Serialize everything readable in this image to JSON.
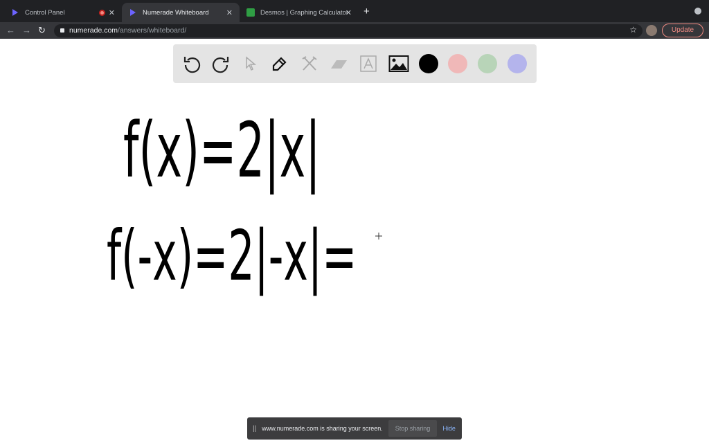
{
  "tabs": [
    {
      "label": "Control Panel",
      "recording": true
    },
    {
      "label": "Numerade Whiteboard",
      "active": true
    },
    {
      "label": "Desmos | Graphing Calculator"
    }
  ],
  "address": {
    "domain": "numerade.com",
    "path": "/answers/whiteboard/"
  },
  "update_label": "Update",
  "whiteboard_tools": [
    "undo",
    "redo",
    "select",
    "pen",
    "tools",
    "eraser",
    "text",
    "image"
  ],
  "colors": {
    "black": "#000000",
    "red": "#f0b8b8",
    "green": "#b8d4b8",
    "blue": "#b4b4ec"
  },
  "handwriting": [
    "f(x)=2|x|",
    "f(-x)=2|-x|="
  ],
  "share_bar": {
    "message": "www.numerade.com is sharing your screen.",
    "stop": "Stop sharing",
    "hide": "Hide"
  }
}
